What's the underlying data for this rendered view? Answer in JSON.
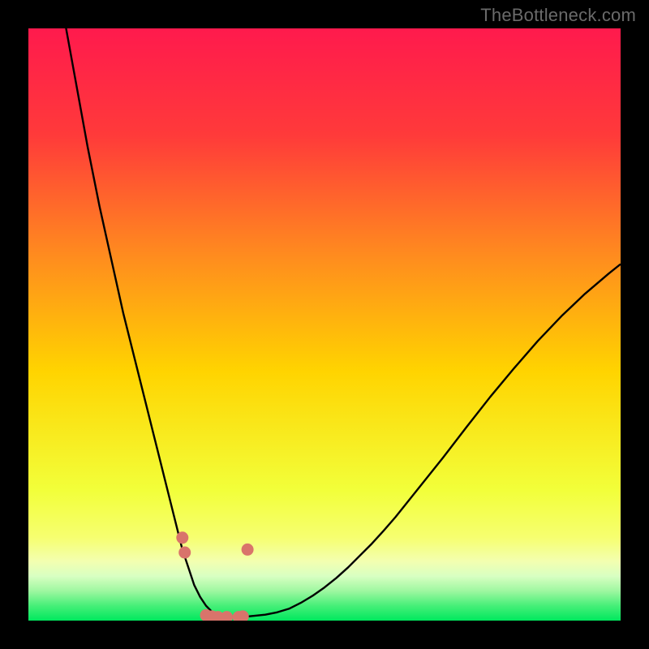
{
  "attribution": "TheBottleneck.com",
  "colors": {
    "frame": "#000000",
    "grad_top": "#ff1a4d",
    "grad_upper": "#ff5a2a",
    "grad_mid": "#ffd400",
    "grad_low": "#f6ff70",
    "grad_band_pale": "#f3ffb0",
    "grad_bottom": "#00e85e",
    "curve": "#000000",
    "marker": "#d9746b"
  },
  "chart_data": {
    "type": "line",
    "title": "",
    "xlabel": "",
    "ylabel": "",
    "xlim": [
      0,
      100
    ],
    "ylim": [
      0,
      100
    ],
    "x": [
      0,
      2,
      4,
      6,
      8,
      10,
      12,
      14,
      16,
      18,
      20,
      21,
      22,
      23,
      24,
      25,
      26,
      27,
      28,
      29,
      30,
      31,
      32,
      33,
      34,
      35,
      36,
      38,
      40,
      42,
      44,
      46,
      48,
      50,
      52,
      54,
      56,
      58,
      60,
      62,
      64,
      66,
      68,
      70,
      74,
      78,
      82,
      86,
      90,
      94,
      98,
      100
    ],
    "y": [
      135,
      124,
      113,
      102,
      91,
      80,
      70,
      61,
      52,
      44,
      36,
      32,
      28,
      24,
      20,
      16,
      12,
      9,
      6,
      4,
      2.5,
      1.5,
      1,
      0.8,
      0.6,
      0.6,
      0.6,
      0.8,
      1,
      1.4,
      2,
      3,
      4.2,
      5.6,
      7.2,
      9,
      11,
      13,
      15.2,
      17.5,
      20,
      22.5,
      25,
      27.5,
      32.7,
      37.8,
      42.6,
      47.2,
      51.4,
      55.2,
      58.6,
      60.2
    ],
    "markers": {
      "x": [
        26.0,
        26.4,
        30.0,
        31.0,
        32.0,
        33.5,
        35.5,
        36.2,
        37.0
      ],
      "y": [
        14.0,
        11.5,
        0.9,
        0.7,
        0.6,
        0.6,
        0.6,
        0.7,
        12.0
      ]
    }
  }
}
